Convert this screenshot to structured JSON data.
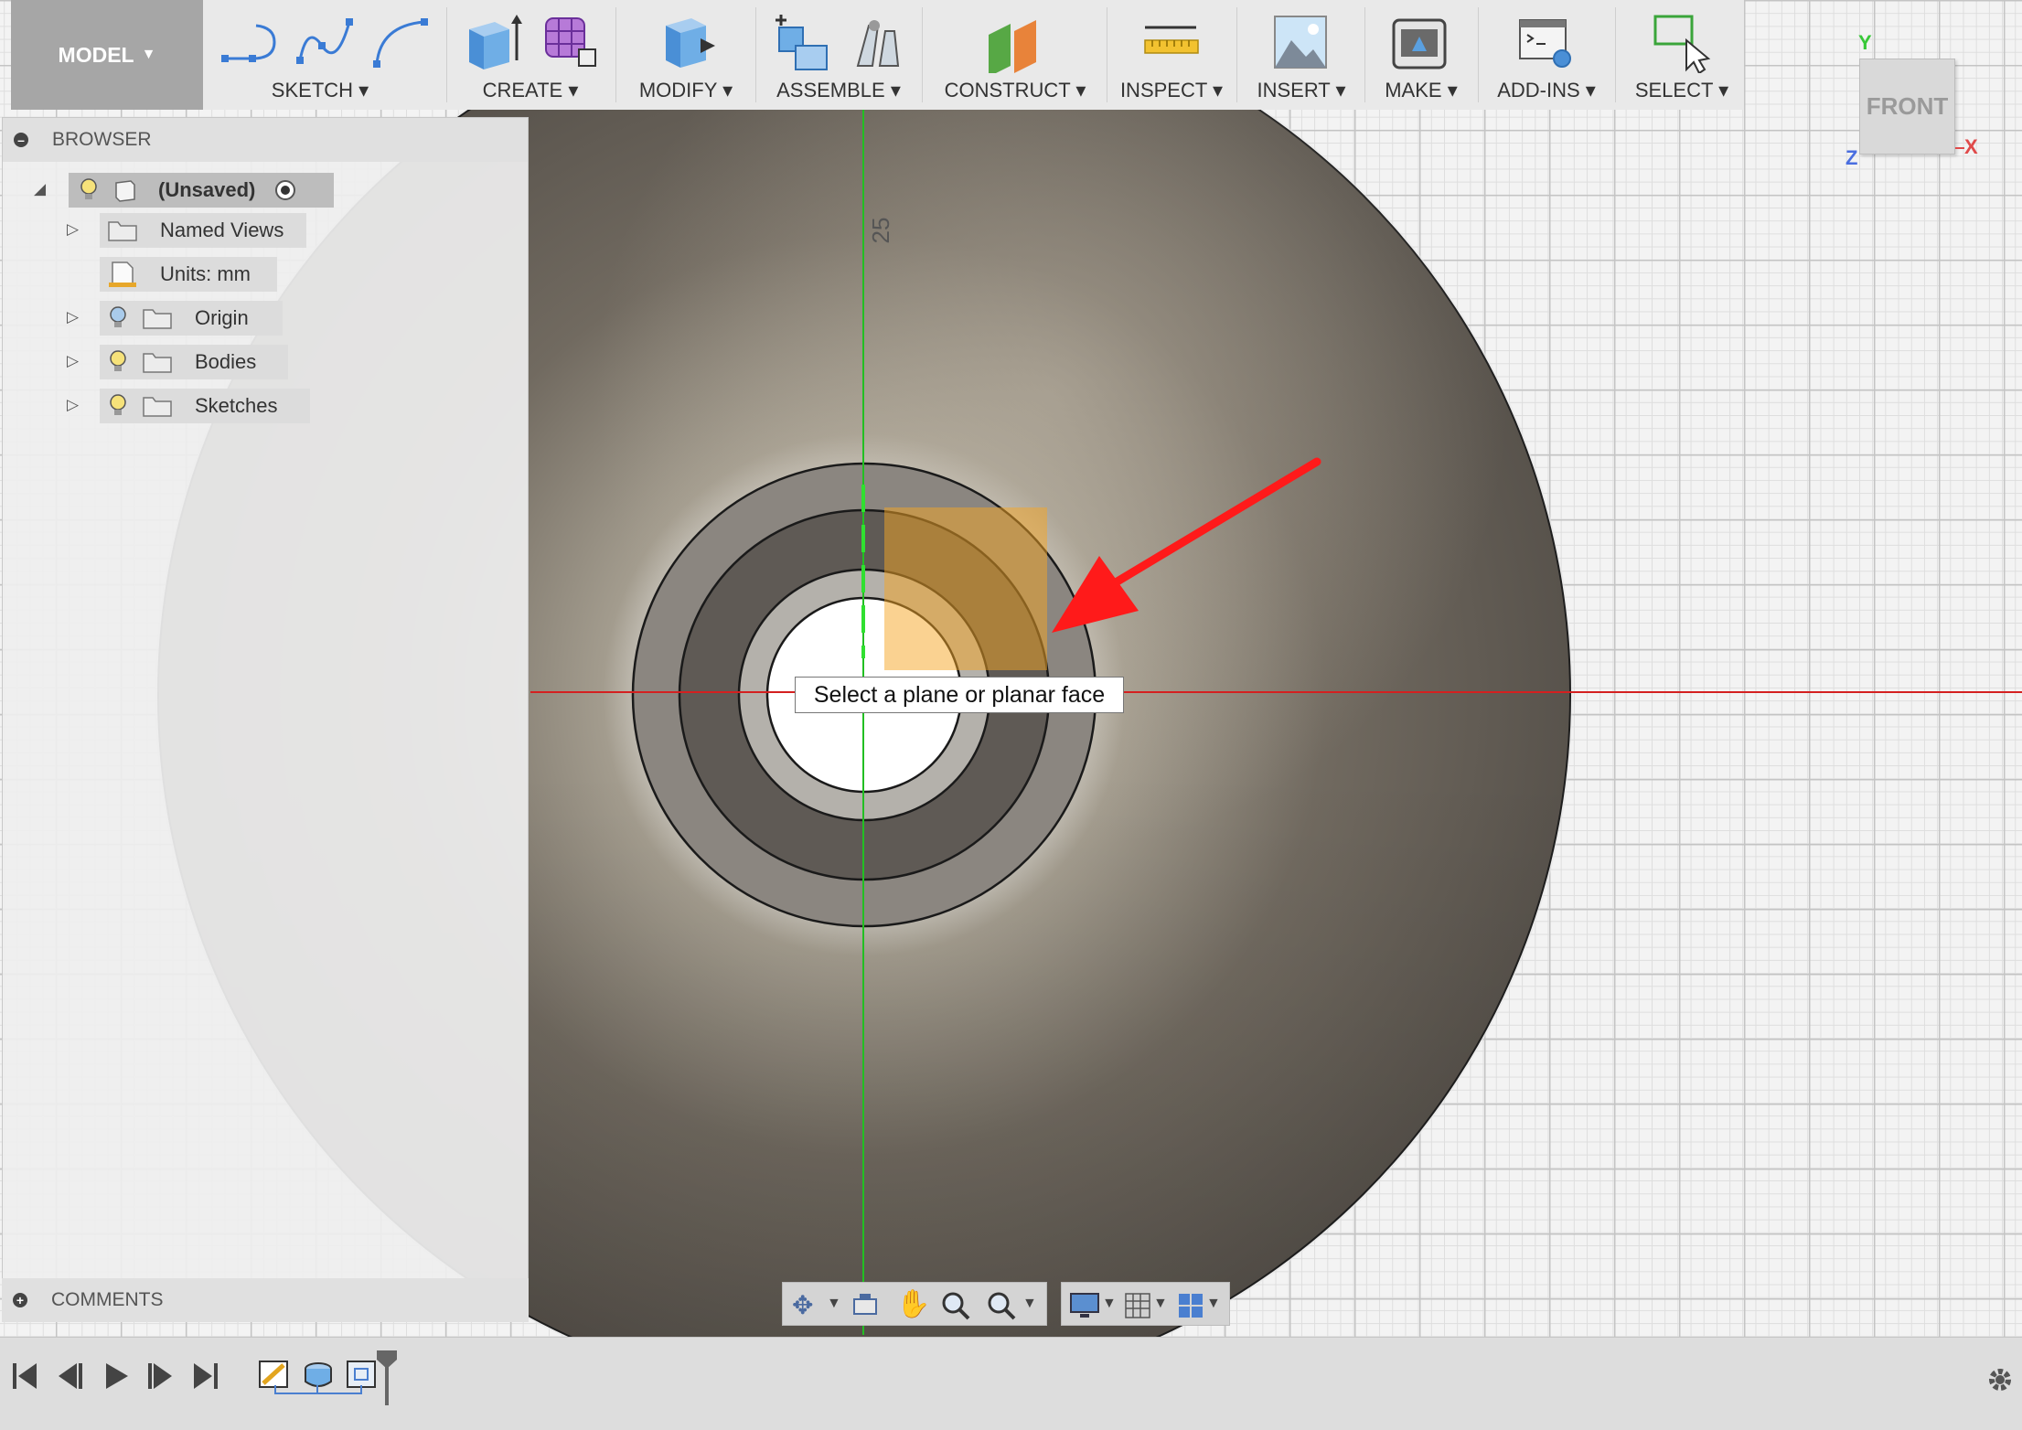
{
  "toolbar": {
    "model_label": "MODEL",
    "groups": [
      {
        "label": "SKETCH"
      },
      {
        "label": "CREATE"
      },
      {
        "label": "MODIFY"
      },
      {
        "label": "ASSEMBLE"
      },
      {
        "label": "CONSTRUCT"
      },
      {
        "label": "INSPECT"
      },
      {
        "label": "INSERT"
      },
      {
        "label": "MAKE"
      },
      {
        "label": "ADD-INS"
      },
      {
        "label": "SELECT"
      }
    ]
  },
  "browser": {
    "title": "BROWSER",
    "root": "(Unsaved)",
    "items": [
      {
        "label": "Named Views"
      },
      {
        "label": "Units: mm"
      },
      {
        "label": "Origin"
      },
      {
        "label": "Bodies"
      },
      {
        "label": "Sketches"
      }
    ]
  },
  "comments": {
    "title": "COMMENTS"
  },
  "canvas": {
    "dimension_label": "25",
    "tooltip": "Select a plane or planar face"
  },
  "viewcube": {
    "face": "FRONT",
    "axis_y": "Y",
    "axis_x": "X",
    "axis_z": "Z"
  },
  "colors": {
    "axis_red": "#e02020",
    "axis_green": "#2ec82e",
    "arrow": "#ff1a1a",
    "highlight": "#f5a623"
  }
}
